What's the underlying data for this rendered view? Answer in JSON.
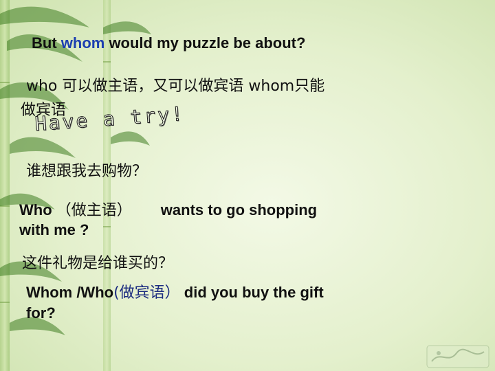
{
  "question": {
    "prefix": "But ",
    "highlight": "whom",
    "suffix": " would my puzzle be about?"
  },
  "rule": {
    "line1": "who  可以做主语，又可以做宾语  whom只能",
    "line2": "做宾语"
  },
  "try_label": "Have a try!",
  "example1": {
    "cn": "谁想跟我去购物？",
    "en_who": "Who",
    "en_note": "（做主语）",
    "en_rest": "wants to go shopping",
    "en_line2": "with  me ?"
  },
  "example2": {
    "cn": "这件礼物是给谁买的？",
    "en_who": "Whom /Who",
    "en_note": "(做宾语）",
    "en_rest": " did you buy the gift",
    "en_line2": "for?"
  },
  "colors": {
    "background": "#e4f0cd",
    "highlight": "#1c3fb0",
    "bamboo": "#4f8a2c"
  }
}
